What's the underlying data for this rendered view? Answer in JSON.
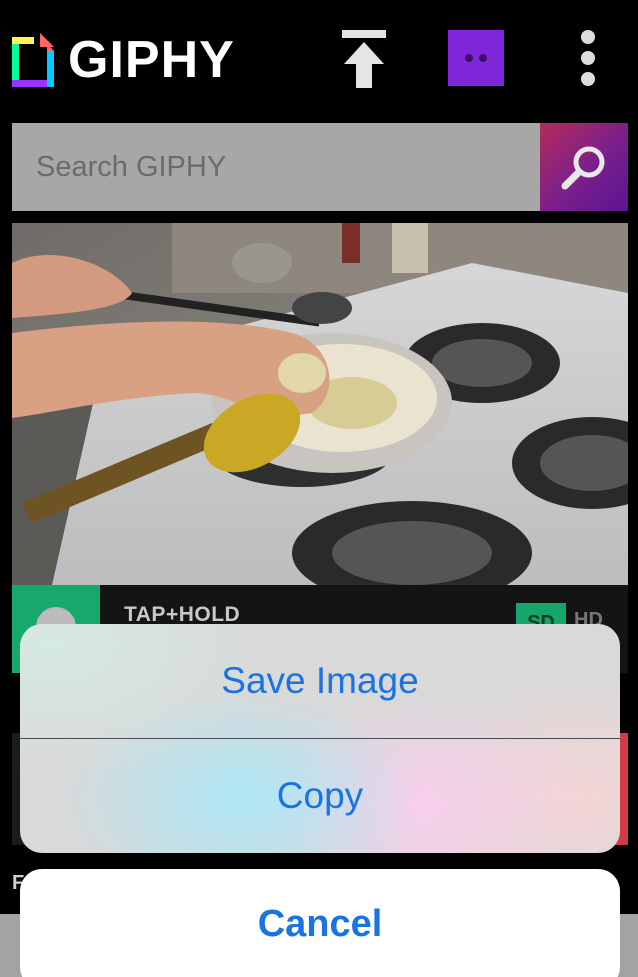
{
  "header": {
    "logo_text": "GIPHY",
    "logo_colors": [
      "#ff6666",
      "#fff35c",
      "#00ff99",
      "#00ccff",
      "#9933ff"
    ],
    "upload_icon": "upload-arrow-icon",
    "channel_color": "#7f26d9",
    "menu_icon": "more-vertical-icon"
  },
  "search": {
    "placeholder": "Search GIPHY",
    "value": "",
    "button_icon": "search-icon"
  },
  "gif_card": {
    "image_description_icon": "gif-image",
    "tap_hold_label": "TAP+HOLD",
    "sd_label": "SD",
    "hd_label": "HD"
  },
  "next_card": {
    "label_fragment": "F"
  },
  "action_sheet": {
    "save_label": "Save Image",
    "copy_label": "Copy",
    "cancel_label": "Cancel",
    "accent_color": "#1a73e0"
  }
}
